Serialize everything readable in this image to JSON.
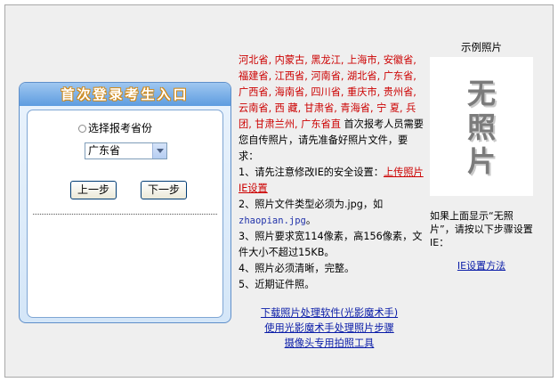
{
  "login": {
    "title": "首次登录考生入口",
    "radio_label": "选择报考省份",
    "province_selected": "广东省",
    "prev_button": "上一步",
    "next_button": "下一步"
  },
  "info": {
    "provinces": "河北省, 内蒙古, 黑龙江, 上海市, 安徽省, 福建省, 江西省, 河南省, 湖北省, 广东省, 广西省, 海南省, 四川省, 重庆市, 贵州省, 云南省, 西 藏, 甘肃省, 青海省, 宁 夏, 兵 团, 甘肃兰州, 广东省直",
    "intro": " 首次报考人员需要您自传照片，请先准备好照片文件，要求：",
    "item1_prefix": "1、请先注意修改IE的安全设置：",
    "item1_link": "上传照片IE设置",
    "item2_prefix": "2、照片文件类型必须为.jpg，如",
    "item2_example": "zhaopian.jpg",
    "item2_suffix": "。",
    "item3": "3、照片要求宽114像素，高156像素，文件大小不超过15KB。",
    "item4": "4、照片必须清晰，完整。",
    "item5": "5、近期证件照。"
  },
  "links": {
    "download": "下载照片处理软件(光影魔术手)",
    "steps": "使用光影魔术手处理照片步骤",
    "camera": "摄像头专用拍照工具"
  },
  "sample": {
    "label": "示例照片",
    "placeholder_line1": "无",
    "placeholder_line2": "照",
    "placeholder_line3": "片",
    "hint": "如果上面显示“无照片”，请按以下步骤设置IE：",
    "ie_link": "IE设置方法"
  }
}
